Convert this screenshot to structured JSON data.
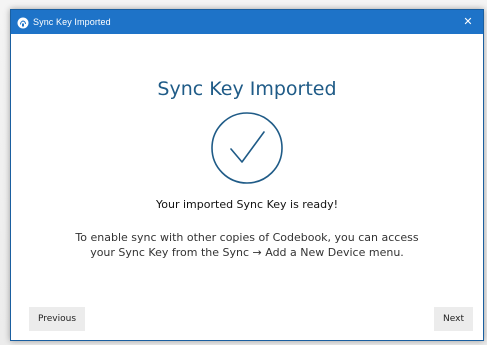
{
  "window": {
    "title": "Sync Key Imported",
    "close_glyph": "✕",
    "app_icon": "codebook-app-icon",
    "titlebar_color": "#1e73c8"
  },
  "main": {
    "heading": "Sync Key Imported",
    "status_icon": "check-circle-icon",
    "accent_color": "#1f5b87",
    "ready_message": "Your imported Sync Key is ready!",
    "info_line1": "To enable sync with other copies of Codebook, you can access",
    "info_line2": "your Sync Key from the Sync → Add a New Device menu."
  },
  "footer": {
    "previous_label": "Previous",
    "next_label": "Next"
  }
}
